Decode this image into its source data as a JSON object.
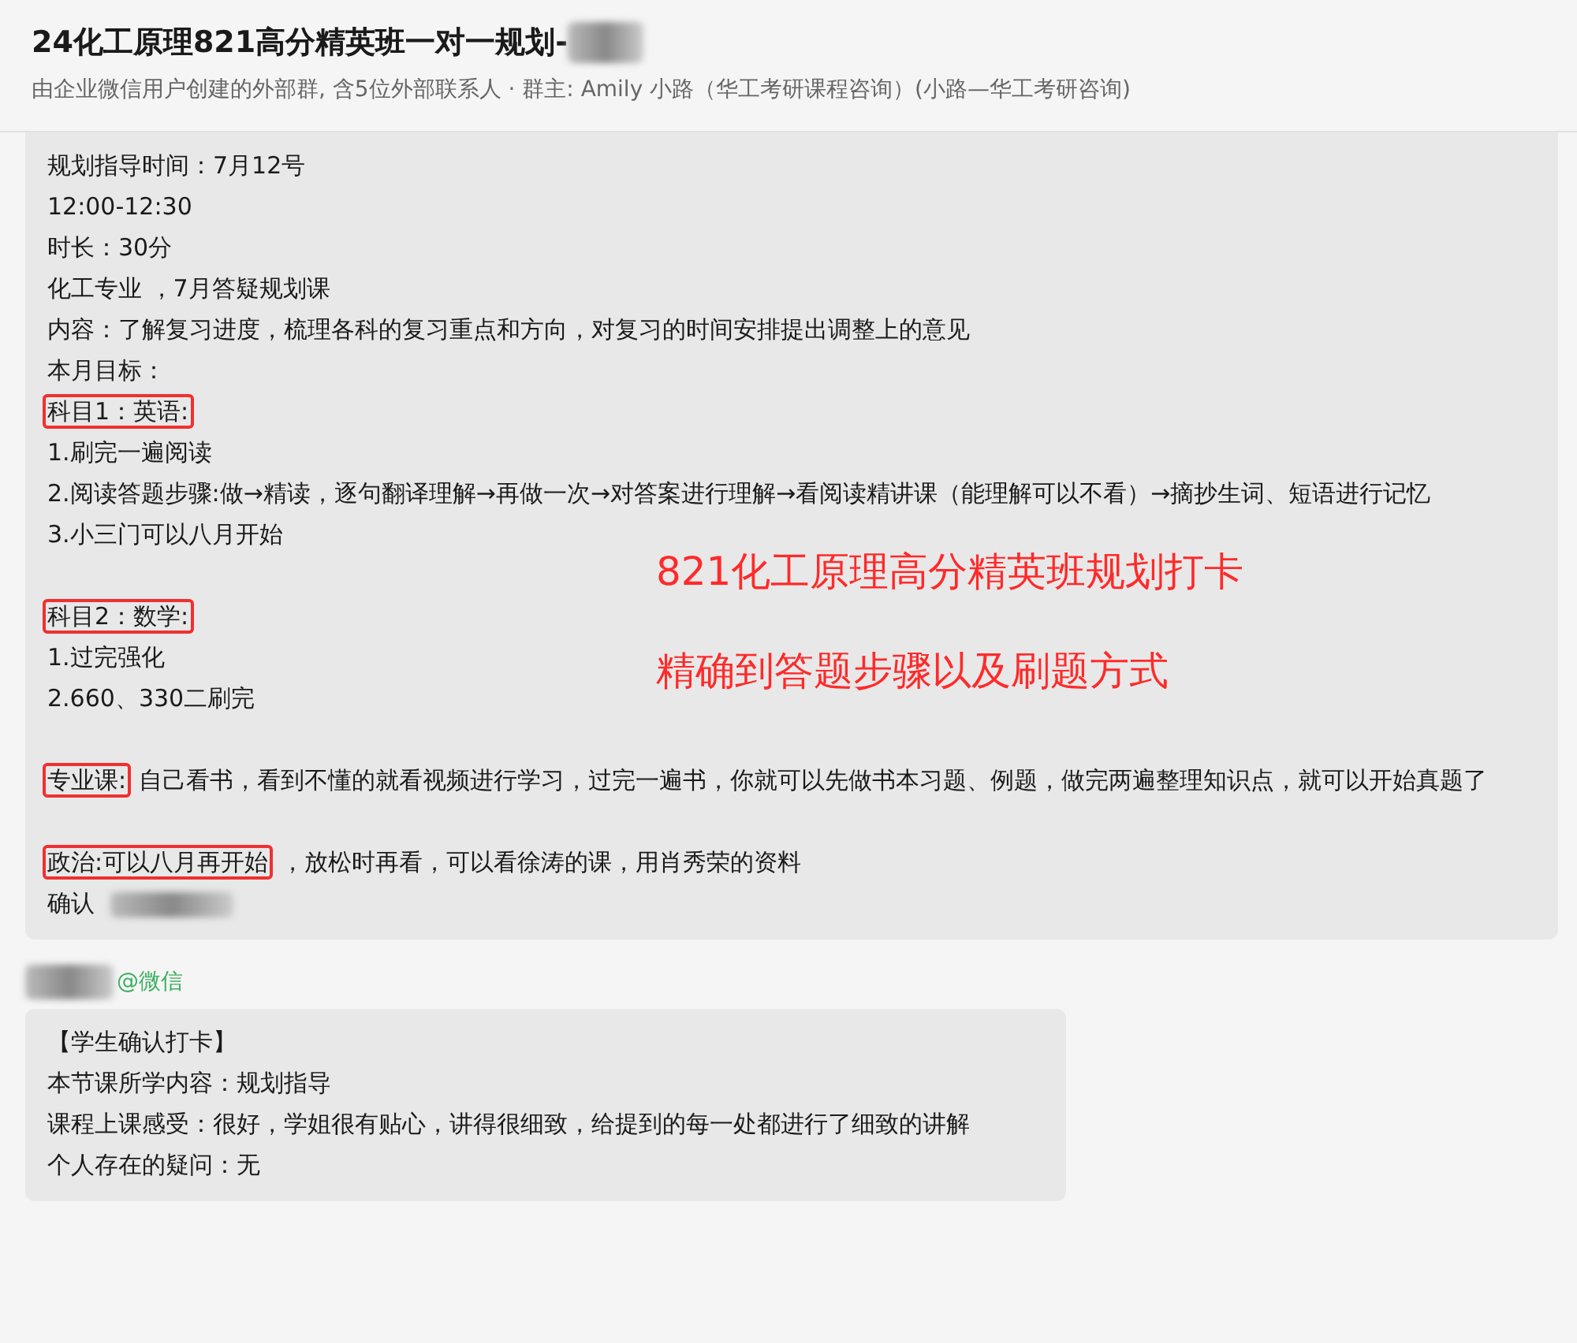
{
  "header": {
    "title": "24化工原理821高分精英班一对一规划-",
    "title_redacted": true,
    "subtitle": "由企业微信用户创建的外部群, 含5位外部联系人 · 群主: Amily 小路（华工考研课程咨询）(小路—华工考研咨询)"
  },
  "messages": [
    {
      "lines": [
        {
          "kind": "text",
          "segments": [
            {
              "text": "规划指导时间：7月12号",
              "marked": false
            }
          ]
        },
        {
          "kind": "text",
          "segments": [
            {
              "text": "12:00-12:30",
              "marked": false
            }
          ]
        },
        {
          "kind": "text",
          "segments": [
            {
              "text": "时长：30分",
              "marked": false
            }
          ]
        },
        {
          "kind": "text",
          "segments": [
            {
              "text": "化工专业 ，7月答疑规划课",
              "marked": false
            }
          ]
        },
        {
          "kind": "text",
          "segments": [
            {
              "text": "内容：了解复习进度，梳理各科的复习重点和方向，对复习的时间安排提出调整上的意见",
              "marked": false
            }
          ]
        },
        {
          "kind": "text",
          "segments": [
            {
              "text": "本月目标：",
              "marked": false
            }
          ]
        },
        {
          "kind": "text",
          "segments": [
            {
              "text": "科目1：英语:",
              "marked": true
            }
          ]
        },
        {
          "kind": "text",
          "segments": [
            {
              "text": "1.刷完一遍阅读",
              "marked": false
            }
          ]
        },
        {
          "kind": "text",
          "segments": [
            {
              "text": "2.阅读答题步骤:做→精读，逐句翻译理解→再做一次→对答案进行理解→看阅读精讲课（能理解可以不看）→摘抄生词、短语进行记忆",
              "marked": false
            }
          ]
        },
        {
          "kind": "text",
          "segments": [
            {
              "text": "3.小三门可以八月开始",
              "marked": false
            }
          ]
        },
        {
          "kind": "blank"
        },
        {
          "kind": "text",
          "segments": [
            {
              "text": "科目2：数学:",
              "marked": true
            }
          ]
        },
        {
          "kind": "text",
          "segments": [
            {
              "text": "1.过完强化",
              "marked": false
            }
          ]
        },
        {
          "kind": "text",
          "segments": [
            {
              "text": "2.660、330二刷完",
              "marked": false
            }
          ]
        },
        {
          "kind": "blank"
        },
        {
          "kind": "text",
          "segments": [
            {
              "text": "专业课:",
              "marked": true
            },
            {
              "text": "自己看书，看到不懂的就看视频进行学习，过完一遍书，你就可以先做书本习题、例题，做完两遍整理知识点，就可以开始真题了",
              "marked": false
            }
          ]
        },
        {
          "kind": "blank"
        },
        {
          "kind": "text",
          "segments": [
            {
              "text": "政治:可以八月再开始",
              "marked": true
            },
            {
              "text": "，放松时再看，可以看徐涛的课，用肖秀荣的资料",
              "marked": false
            }
          ]
        },
        {
          "kind": "text",
          "redacted_after": true,
          "segments": [
            {
              "text": "确认",
              "marked": false
            }
          ]
        }
      ],
      "annotations": [
        "821化工原理高分精英班规划打卡",
        "精确到答题步骤以及刷题方式"
      ]
    },
    {
      "sender_redacted": true,
      "sender_suffix": "@微信",
      "lines": [
        {
          "kind": "text",
          "segments": [
            {
              "text": "【学生确认打卡】",
              "marked": false
            }
          ]
        },
        {
          "kind": "text",
          "segments": [
            {
              "text": "本节课所学内容：规划指导",
              "marked": false
            }
          ]
        },
        {
          "kind": "text",
          "segments": [
            {
              "text": "课程上课感受：很好，学姐很有贴心，讲得很细致，给提到的每一处都进行了细致的讲解",
              "marked": false
            }
          ]
        },
        {
          "kind": "text",
          "segments": [
            {
              "text": "个人存在的疑问：无",
              "marked": false
            }
          ]
        }
      ]
    }
  ]
}
